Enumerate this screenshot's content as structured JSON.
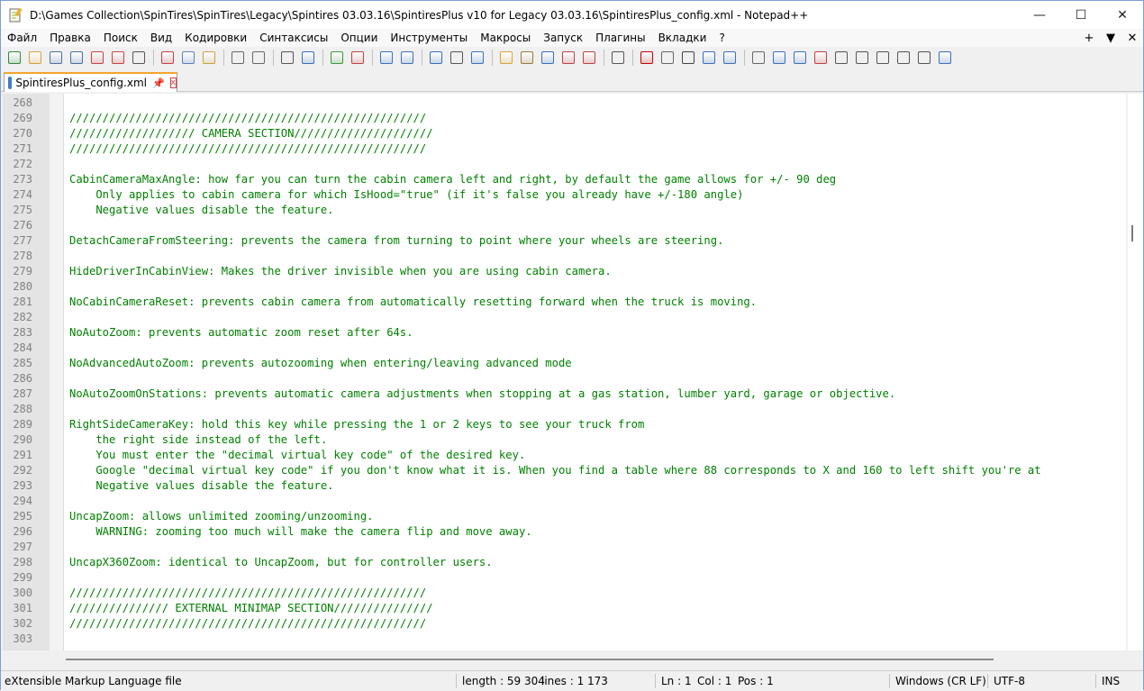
{
  "window": {
    "title": "D:\\Games Collection\\SpinTires\\SpinTires\\Legacy\\Spintires 03.03.16\\SpintiresPlus v10 for Legacy 03.03.16\\SpintiresPlus_config.xml - Notepad++",
    "minimize": "—",
    "maximize": "☐",
    "close": "✕"
  },
  "menu": {
    "items": [
      "Файл",
      "Правка",
      "Поиск",
      "Вид",
      "Кодировки",
      "Синтаксисы",
      "Опции",
      "Инструменты",
      "Макросы",
      "Запуск",
      "Плагины",
      "Вкладки",
      "?"
    ],
    "right": [
      "+",
      "▼",
      "✕"
    ]
  },
  "toolbar": {
    "icons": [
      "new-file-icon",
      "open-file-icon",
      "save-icon",
      "save-all-icon",
      "close-icon",
      "close-all-icon",
      "print-icon",
      "sep",
      "cut-icon",
      "copy-icon",
      "paste-icon",
      "sep",
      "undo-icon",
      "redo-icon",
      "sep",
      "find-icon",
      "replace-icon",
      "sep",
      "zoom-in-icon",
      "zoom-out-icon",
      "sep",
      "sync-vertical-icon",
      "sync-horizontal-icon",
      "sep",
      "word-wrap-icon",
      "all-chars-icon",
      "indent-guide-icon",
      "sep",
      "lang-icon",
      "doc-map-icon",
      "function-list-icon",
      "folder-workspace-icon",
      "doc-list-icon",
      "sep",
      "monitor-icon",
      "sep",
      "record-macro-icon",
      "stop-macro-icon",
      "play-macro-icon",
      "run-multiple-macro-icon",
      "save-macro-icon",
      "sep",
      "insert-icon",
      "bookmark-icon",
      "next-icon",
      "prev-icon",
      "fold-icon",
      "up-icon",
      "down-icon",
      "hide-icon",
      "clipboard-icon",
      "split-icon"
    ],
    "colors": {
      "accent": "#f3a42d",
      "code": "#008000",
      "linenum": "#808080"
    }
  },
  "tab": {
    "label": "SpintiresPlus_config.xml",
    "pin": "📌",
    "close": "x"
  },
  "editor": {
    "lines": [
      {
        "n": "268",
        "t": ""
      },
      {
        "n": "269",
        "t": "//////////////////////////////////////////////////////"
      },
      {
        "n": "270",
        "t": "/////////////////// CAMERA SECTION/////////////////////"
      },
      {
        "n": "271",
        "t": "//////////////////////////////////////////////////////"
      },
      {
        "n": "272",
        "t": ""
      },
      {
        "n": "273",
        "t": "CabinCameraMaxAngle: how far you can turn the cabin camera left and right, by default the game allows for +/- 90 deg"
      },
      {
        "n": "274",
        "t": "    Only applies to cabin camera for which IsHood=\"true\" (if it's false you already have +/-180 angle)"
      },
      {
        "n": "275",
        "t": "    Negative values disable the feature."
      },
      {
        "n": "276",
        "t": ""
      },
      {
        "n": "277",
        "t": "DetachCameraFromSteering: prevents the camera from turning to point where your wheels are steering."
      },
      {
        "n": "278",
        "t": ""
      },
      {
        "n": "279",
        "t": "HideDriverInCabinView: Makes the driver invisible when you are using cabin camera."
      },
      {
        "n": "280",
        "t": ""
      },
      {
        "n": "281",
        "t": "NoCabinCameraReset: prevents cabin camera from automatically resetting forward when the truck is moving."
      },
      {
        "n": "282",
        "t": ""
      },
      {
        "n": "283",
        "t": "NoAutoZoom: prevents automatic zoom reset after 64s."
      },
      {
        "n": "284",
        "t": ""
      },
      {
        "n": "285",
        "t": "NoAdvancedAutoZoom: prevents autozooming when entering/leaving advanced mode"
      },
      {
        "n": "286",
        "t": ""
      },
      {
        "n": "287",
        "t": "NoAutoZoomOnStations: prevents automatic camera adjustments when stopping at a gas station, lumber yard, garage or objective."
      },
      {
        "n": "288",
        "t": ""
      },
      {
        "n": "289",
        "t": "RightSideCameraKey: hold this key while pressing the 1 or 2 keys to see your truck from"
      },
      {
        "n": "290",
        "t": "    the right side instead of the left."
      },
      {
        "n": "291",
        "t": "    You must enter the \"decimal virtual key code\" of the desired key."
      },
      {
        "n": "292",
        "t": "    Google \"decimal virtual key code\" if you don't know what it is. When you find a table where 88 corresponds to X and 160 to left shift you're at"
      },
      {
        "n": "293",
        "t": "    Negative values disable the feature."
      },
      {
        "n": "294",
        "t": ""
      },
      {
        "n": "295",
        "t": "UncapZoom: allows unlimited zooming/unzooming."
      },
      {
        "n": "296",
        "t": "    WARNING: zooming too much will make the camera flip and move away."
      },
      {
        "n": "297",
        "t": ""
      },
      {
        "n": "298",
        "t": "UncapX360Zoom: identical to UncapZoom, but for controller users."
      },
      {
        "n": "299",
        "t": ""
      },
      {
        "n": "300",
        "t": "//////////////////////////////////////////////////////"
      },
      {
        "n": "301",
        "t": "/////////////// EXTERNAL MINIMAP SECTION///////////////"
      },
      {
        "n": "302",
        "t": "//////////////////////////////////////////////////////"
      },
      {
        "n": "303",
        "t": ""
      }
    ]
  },
  "status": {
    "filetype": "eXtensible Markup Language file",
    "length": "length : 59 304",
    "lines": "lines : 1 173",
    "ln": "Ln : 1",
    "col": "Col : 1",
    "pos": "Pos : 1",
    "eol": "Windows (CR LF)",
    "encoding": "UTF-8",
    "mode": "INS"
  }
}
